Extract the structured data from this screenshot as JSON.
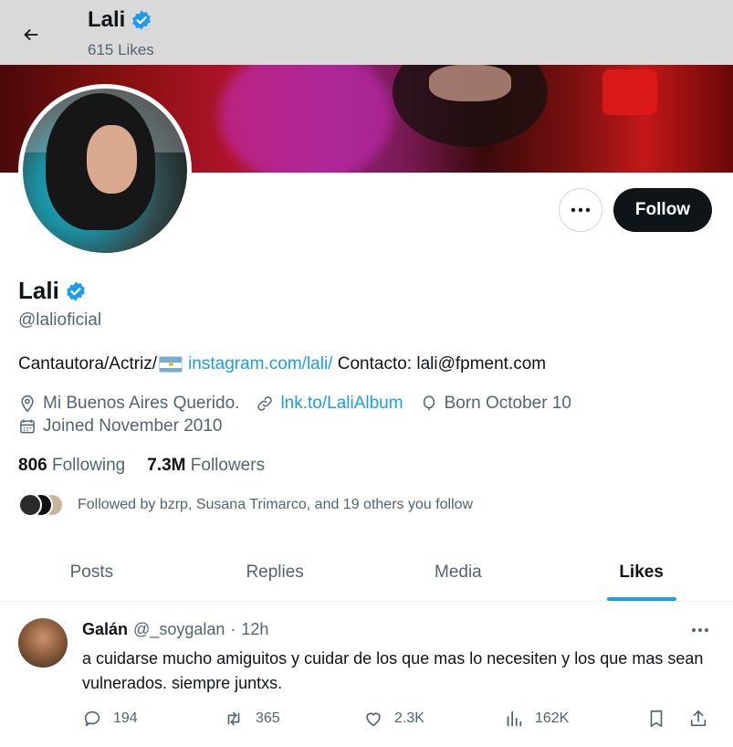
{
  "header": {
    "title": "Lali",
    "likes_count": "615 Likes"
  },
  "profile": {
    "name": "Lali",
    "handle": "@lalioficial",
    "bio_text": "Cantautora/Actriz/",
    "bio_link": "instagram.com/lali/",
    "bio_contact": "Contacto: lali@fpment.com",
    "location": "Mi Buenos Aires Querido.",
    "website": "lnk.to/LaliAlbum",
    "birthday": "Born October 10",
    "joined": "Joined November 2010",
    "following_count": "806",
    "following_label": "Following",
    "followers_count": "7.3M",
    "followers_label": "Followers",
    "followed_by": "Followed by bzrp, Susana Trimarco, and 19 others you follow",
    "follow_button": "Follow"
  },
  "tabs": [
    {
      "label": "Posts"
    },
    {
      "label": "Replies"
    },
    {
      "label": "Media"
    },
    {
      "label": "Likes",
      "active": true
    }
  ],
  "tweet": {
    "author_name": "Galán",
    "author_handle": "@_soygalan",
    "separator": "·",
    "time": "12h",
    "text": "a cuidarse mucho amiguitos y cuidar de los que mas lo necesiten y los que mas sean vulnerados. siempre juntxs.",
    "replies": "194",
    "reposts": "365",
    "likes": "2.3K",
    "views": "162K"
  },
  "colors": {
    "accent": "#1d9bf0",
    "text_primary": "#0f1419",
    "text_secondary": "#536471",
    "follow_button_bg": "#0f1419"
  },
  "icons": [
    "back-arrow-icon",
    "verified-badge-icon",
    "more-icon",
    "location-icon",
    "link-icon",
    "birthday-icon",
    "calendar-icon",
    "reply-icon",
    "repost-icon",
    "like-icon",
    "views-icon",
    "bookmark-icon",
    "share-icon"
  ]
}
